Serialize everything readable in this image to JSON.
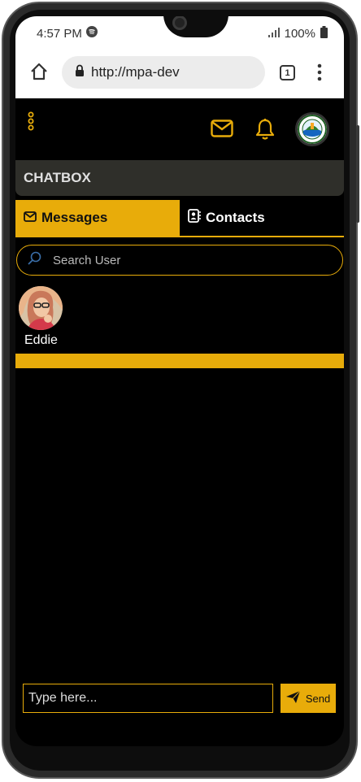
{
  "status": {
    "time": "4:57 PM",
    "battery": "100%"
  },
  "browser": {
    "url": "http://mpa-dev",
    "tab_count": "1"
  },
  "app": {
    "section_title": "CHATBOX"
  },
  "tabs": [
    {
      "label": "Messages",
      "active": true
    },
    {
      "label": "Contacts",
      "active": false
    }
  ],
  "search": {
    "placeholder": "Search User"
  },
  "users": [
    {
      "name": "Eddie"
    }
  ],
  "compose": {
    "placeholder": "Type here...",
    "send_label": "Send"
  },
  "colors": {
    "accent": "#e8ac0a",
    "background": "#000000",
    "header_bar": "#2f2f2a"
  }
}
